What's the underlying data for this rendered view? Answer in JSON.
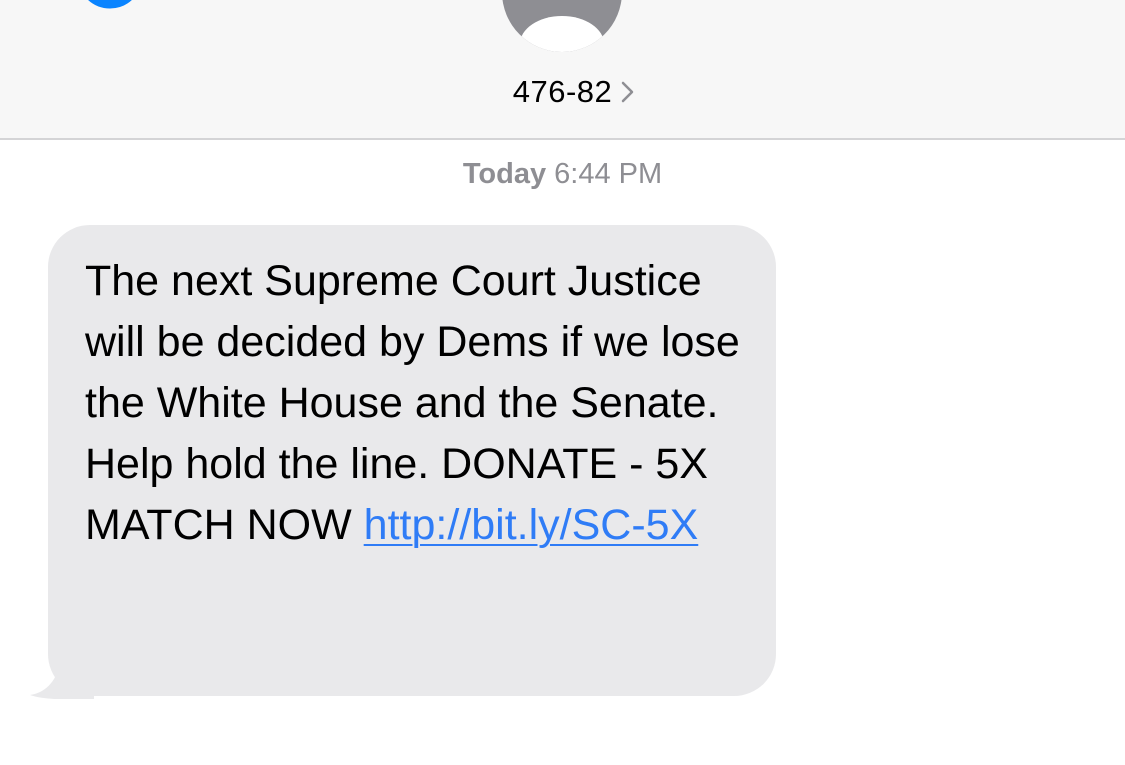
{
  "header": {
    "contact_name": "476-82"
  },
  "thread": {
    "timestamp_day": "Today",
    "timestamp_time": "6:44 PM",
    "messages": [
      {
        "text": "The next Supreme Court Justice will be decided by Dems if we lose the White House and the Senate. Help hold the line. DONATE - 5X MATCH NOW ",
        "link": "http://bit.ly/SC-5X"
      }
    ]
  },
  "colors": {
    "header_bg": "#f7f7f7",
    "bubble_bg": "#e9e9eb",
    "link": "#2f7cf6",
    "accent": "#0a84ff",
    "timestamp": "#8e8e93"
  },
  "icons": [
    "back-chevron-icon",
    "contact-avatar-icon",
    "chevron-right-icon"
  ]
}
